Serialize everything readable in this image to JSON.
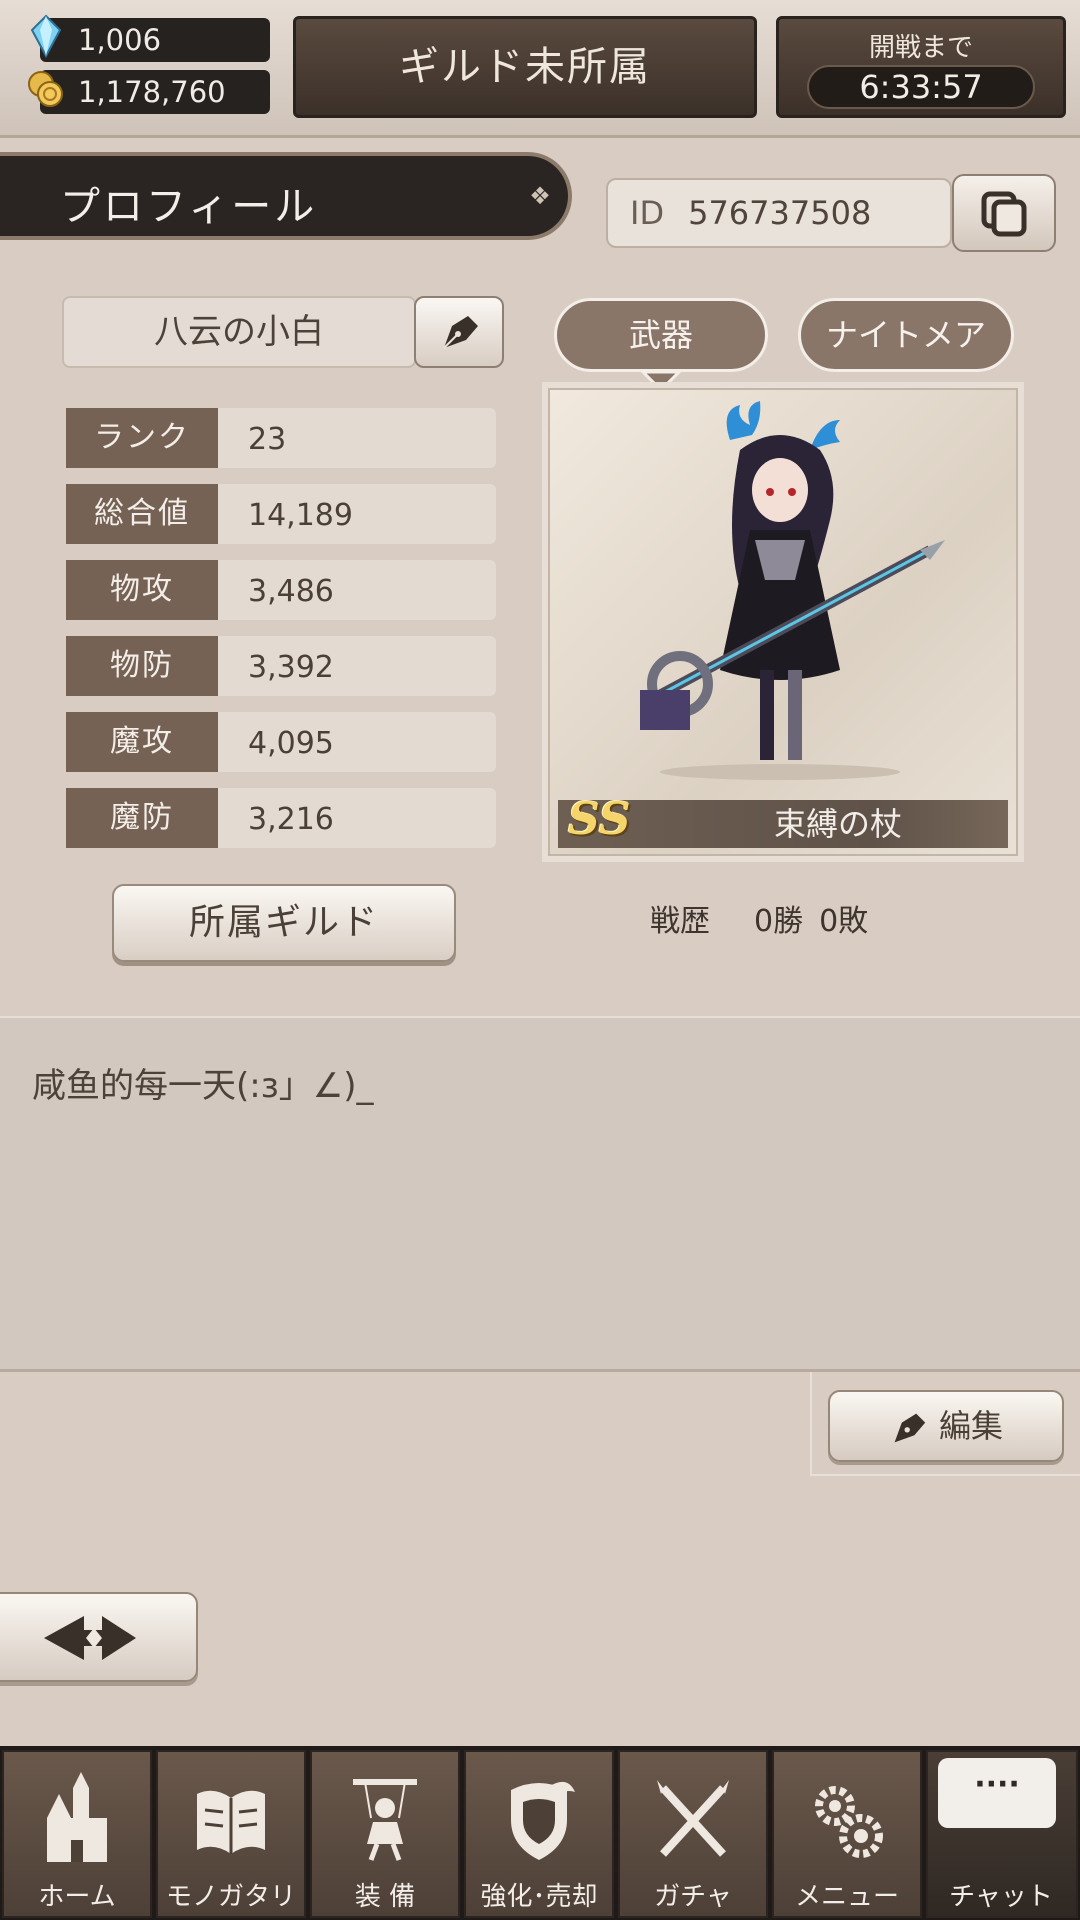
{
  "header": {
    "gems": "1,006",
    "coins": "1,178,760",
    "guild_status": "ギルド未所属",
    "battle_label": "開戦まで",
    "battle_timer": "6:33:57"
  },
  "profile": {
    "title": "プロフィール",
    "id_label": "ID",
    "id_value": "576737508",
    "name": "八云の小白",
    "stats": [
      {
        "label": "ランク",
        "value": "23"
      },
      {
        "label": "総合値",
        "value": "14,189"
      },
      {
        "label": "物攻",
        "value": "3,486"
      },
      {
        "label": "物防",
        "value": "3,392"
      },
      {
        "label": "魔攻",
        "value": "4,095"
      },
      {
        "label": "魔防",
        "value": "3,216"
      }
    ],
    "guild_button": "所属ギルド",
    "tabs": {
      "weapon": "武器",
      "nightmare": "ナイトメア"
    },
    "weapon": {
      "rank": "SS",
      "name": "束縛の杖"
    },
    "record": {
      "label": "戦歴",
      "wins": "0勝",
      "losses": "0敗"
    },
    "comment": "咸鱼的每一天(:з」∠)_",
    "edit_button": "編集"
  },
  "nav": {
    "items": [
      {
        "label": "ホーム",
        "icon": "castle-icon"
      },
      {
        "label": "モノガタリ",
        "icon": "book-icon"
      },
      {
        "label": "装 備",
        "icon": "puppet-icon"
      },
      {
        "label": "強化･売却",
        "icon": "shield-icon"
      },
      {
        "label": "ガチャ",
        "icon": "crossed-swords-icon"
      },
      {
        "label": "メニュー",
        "icon": "gears-icon"
      }
    ],
    "chat_label": "チャット",
    "chat_bubble": "····"
  },
  "colors": {
    "panel": "#d8ccc3",
    "dark": "#2a2522",
    "stat_label": "#756255",
    "accent": "#f5d46b"
  }
}
